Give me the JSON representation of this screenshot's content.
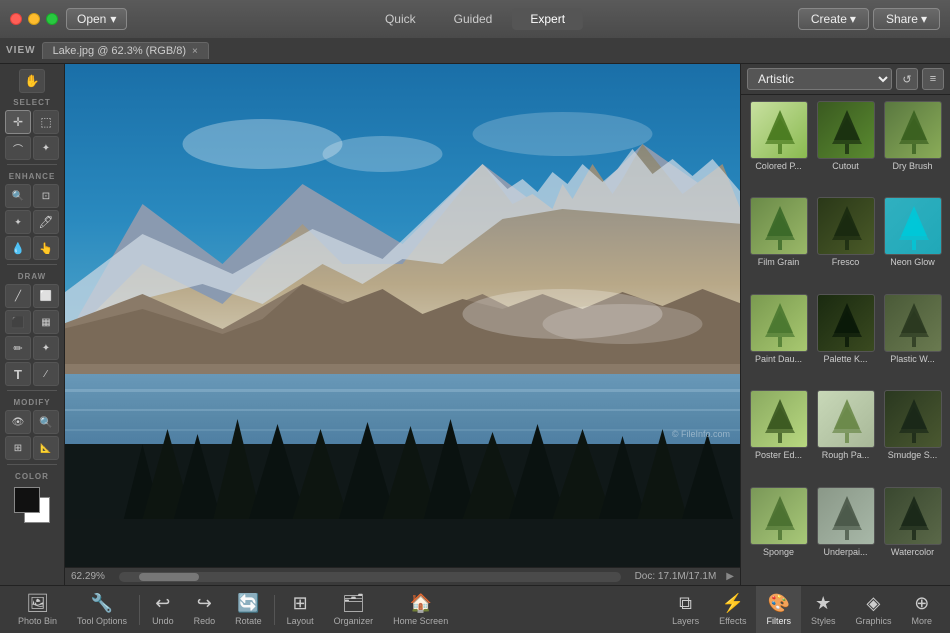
{
  "titlebar": {
    "open_label": "Open",
    "create_label": "Create",
    "share_label": "Share",
    "nav": {
      "quick": "Quick",
      "guided": "Guided",
      "expert": "Expert"
    },
    "active_nav": "Expert"
  },
  "tab": {
    "filename": "Lake.jpg @ 62.3% (RGB/8)",
    "close_label": "×"
  },
  "toolbar": {
    "view_label": "VIEW",
    "select_label": "SELECT",
    "enhance_label": "ENHANCE",
    "draw_label": "DRAW",
    "modify_label": "MODIFY",
    "color_label": "COLOR"
  },
  "canvas": {
    "status_zoom": "62.29%",
    "status_doc": "Doc: 17.1M/17.1M"
  },
  "filters_panel": {
    "title": "Artistic",
    "filters": [
      {
        "id": "colored-pencil",
        "label": "Colored P...",
        "theme": "colored-pencil"
      },
      {
        "id": "cutout",
        "label": "Cutout",
        "theme": "cutout"
      },
      {
        "id": "dry-brush",
        "label": "Dry Brush",
        "theme": "dry-brush"
      },
      {
        "id": "film-grain",
        "label": "Film Grain",
        "theme": "film-grain"
      },
      {
        "id": "fresco",
        "label": "Fresco",
        "theme": "fresco"
      },
      {
        "id": "neon-glow",
        "label": "Neon Glow",
        "theme": "neon-glow"
      },
      {
        "id": "paint-daubs",
        "label": "Paint Dau...",
        "theme": "paint-daubs"
      },
      {
        "id": "palette-knife",
        "label": "Palette K...",
        "theme": "palette-knife"
      },
      {
        "id": "plastic-wrap",
        "label": "Plastic W...",
        "theme": "plastic-wrap"
      },
      {
        "id": "poster-edges",
        "label": "Poster Ed...",
        "theme": "poster-edges"
      },
      {
        "id": "rough-pastels",
        "label": "Rough Pa...",
        "theme": "rough-pastels"
      },
      {
        "id": "smudge-stick",
        "label": "Smudge S...",
        "theme": "smudge-stick"
      },
      {
        "id": "sponge",
        "label": "Sponge",
        "theme": "sponge"
      },
      {
        "id": "underpainting",
        "label": "Underpai...",
        "theme": "underpainting"
      },
      {
        "id": "watercolor",
        "label": "Watercolor",
        "theme": "watercolor"
      }
    ]
  },
  "bottombar": {
    "photo_bin": "Photo Bin",
    "tool_options": "Tool Options",
    "undo": "Undo",
    "redo": "Redo",
    "rotate": "Rotate",
    "layout": "Layout",
    "organizer": "Organizer",
    "home_screen": "Home Screen",
    "layers": "Layers",
    "effects": "Effects",
    "filters": "Filters",
    "styles": "Styles",
    "graphics": "Graphics",
    "more": "More",
    "watermark": "© FileInfo.com"
  }
}
